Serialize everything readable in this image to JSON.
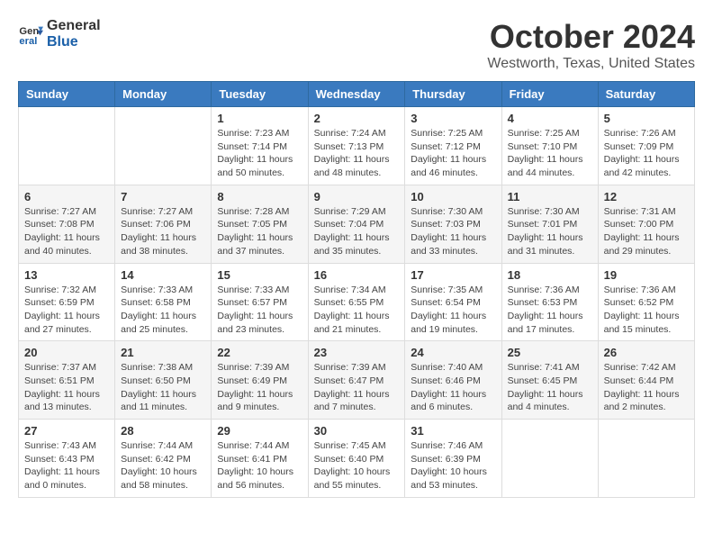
{
  "logo": {
    "text_general": "General",
    "text_blue": "Blue"
  },
  "title": "October 2024",
  "location": "Westworth, Texas, United States",
  "days_of_week": [
    "Sunday",
    "Monday",
    "Tuesday",
    "Wednesday",
    "Thursday",
    "Friday",
    "Saturday"
  ],
  "weeks": [
    [
      {
        "day": "",
        "detail": ""
      },
      {
        "day": "",
        "detail": ""
      },
      {
        "day": "1",
        "detail": "Sunrise: 7:23 AM\nSunset: 7:14 PM\nDaylight: 11 hours and 50 minutes."
      },
      {
        "day": "2",
        "detail": "Sunrise: 7:24 AM\nSunset: 7:13 PM\nDaylight: 11 hours and 48 minutes."
      },
      {
        "day": "3",
        "detail": "Sunrise: 7:25 AM\nSunset: 7:12 PM\nDaylight: 11 hours and 46 minutes."
      },
      {
        "day": "4",
        "detail": "Sunrise: 7:25 AM\nSunset: 7:10 PM\nDaylight: 11 hours and 44 minutes."
      },
      {
        "day": "5",
        "detail": "Sunrise: 7:26 AM\nSunset: 7:09 PM\nDaylight: 11 hours and 42 minutes."
      }
    ],
    [
      {
        "day": "6",
        "detail": "Sunrise: 7:27 AM\nSunset: 7:08 PM\nDaylight: 11 hours and 40 minutes."
      },
      {
        "day": "7",
        "detail": "Sunrise: 7:27 AM\nSunset: 7:06 PM\nDaylight: 11 hours and 38 minutes."
      },
      {
        "day": "8",
        "detail": "Sunrise: 7:28 AM\nSunset: 7:05 PM\nDaylight: 11 hours and 37 minutes."
      },
      {
        "day": "9",
        "detail": "Sunrise: 7:29 AM\nSunset: 7:04 PM\nDaylight: 11 hours and 35 minutes."
      },
      {
        "day": "10",
        "detail": "Sunrise: 7:30 AM\nSunset: 7:03 PM\nDaylight: 11 hours and 33 minutes."
      },
      {
        "day": "11",
        "detail": "Sunrise: 7:30 AM\nSunset: 7:01 PM\nDaylight: 11 hours and 31 minutes."
      },
      {
        "day": "12",
        "detail": "Sunrise: 7:31 AM\nSunset: 7:00 PM\nDaylight: 11 hours and 29 minutes."
      }
    ],
    [
      {
        "day": "13",
        "detail": "Sunrise: 7:32 AM\nSunset: 6:59 PM\nDaylight: 11 hours and 27 minutes."
      },
      {
        "day": "14",
        "detail": "Sunrise: 7:33 AM\nSunset: 6:58 PM\nDaylight: 11 hours and 25 minutes."
      },
      {
        "day": "15",
        "detail": "Sunrise: 7:33 AM\nSunset: 6:57 PM\nDaylight: 11 hours and 23 minutes."
      },
      {
        "day": "16",
        "detail": "Sunrise: 7:34 AM\nSunset: 6:55 PM\nDaylight: 11 hours and 21 minutes."
      },
      {
        "day": "17",
        "detail": "Sunrise: 7:35 AM\nSunset: 6:54 PM\nDaylight: 11 hours and 19 minutes."
      },
      {
        "day": "18",
        "detail": "Sunrise: 7:36 AM\nSunset: 6:53 PM\nDaylight: 11 hours and 17 minutes."
      },
      {
        "day": "19",
        "detail": "Sunrise: 7:36 AM\nSunset: 6:52 PM\nDaylight: 11 hours and 15 minutes."
      }
    ],
    [
      {
        "day": "20",
        "detail": "Sunrise: 7:37 AM\nSunset: 6:51 PM\nDaylight: 11 hours and 13 minutes."
      },
      {
        "day": "21",
        "detail": "Sunrise: 7:38 AM\nSunset: 6:50 PM\nDaylight: 11 hours and 11 minutes."
      },
      {
        "day": "22",
        "detail": "Sunrise: 7:39 AM\nSunset: 6:49 PM\nDaylight: 11 hours and 9 minutes."
      },
      {
        "day": "23",
        "detail": "Sunrise: 7:39 AM\nSunset: 6:47 PM\nDaylight: 11 hours and 7 minutes."
      },
      {
        "day": "24",
        "detail": "Sunrise: 7:40 AM\nSunset: 6:46 PM\nDaylight: 11 hours and 6 minutes."
      },
      {
        "day": "25",
        "detail": "Sunrise: 7:41 AM\nSunset: 6:45 PM\nDaylight: 11 hours and 4 minutes."
      },
      {
        "day": "26",
        "detail": "Sunrise: 7:42 AM\nSunset: 6:44 PM\nDaylight: 11 hours and 2 minutes."
      }
    ],
    [
      {
        "day": "27",
        "detail": "Sunrise: 7:43 AM\nSunset: 6:43 PM\nDaylight: 11 hours and 0 minutes."
      },
      {
        "day": "28",
        "detail": "Sunrise: 7:44 AM\nSunset: 6:42 PM\nDaylight: 10 hours and 58 minutes."
      },
      {
        "day": "29",
        "detail": "Sunrise: 7:44 AM\nSunset: 6:41 PM\nDaylight: 10 hours and 56 minutes."
      },
      {
        "day": "30",
        "detail": "Sunrise: 7:45 AM\nSunset: 6:40 PM\nDaylight: 10 hours and 55 minutes."
      },
      {
        "day": "31",
        "detail": "Sunrise: 7:46 AM\nSunset: 6:39 PM\nDaylight: 10 hours and 53 minutes."
      },
      {
        "day": "",
        "detail": ""
      },
      {
        "day": "",
        "detail": ""
      }
    ]
  ]
}
